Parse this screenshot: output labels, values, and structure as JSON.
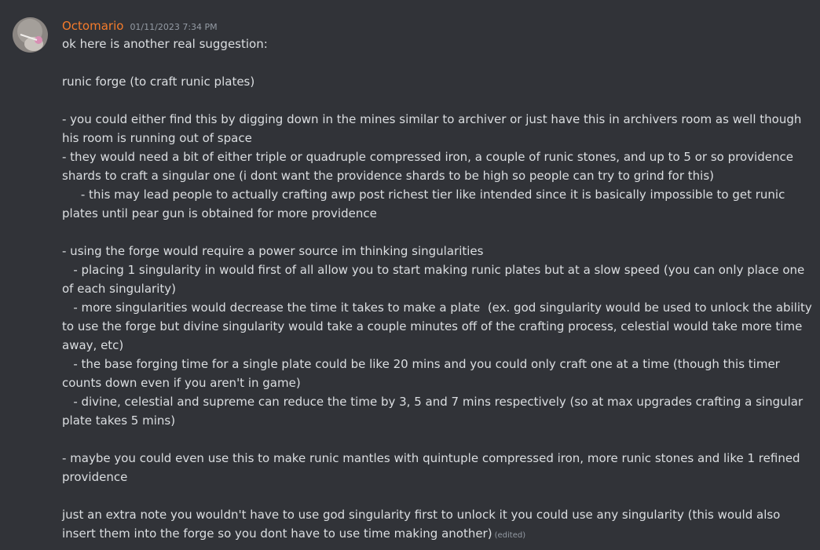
{
  "message": {
    "author": "Octomario",
    "timestamp": "01/11/2023 7:34 PM",
    "edited_label": "(edited)",
    "lines": [
      "ok here is another real suggestion:",
      "",
      "runic forge (to craft runic plates)",
      "",
      "- you could either find this by digging down in the mines similar to archiver or just have this in archivers room as well though his room is running out of space",
      "- they would need a bit of either triple or quadruple compressed iron, a couple of runic stones, and up to 5 or so providence shards to craft a singular one (i dont want the providence shards to be high so people can try to grind for this)",
      "     - this may lead people to actually crafting awp post richest tier like intended since it is basically impossible to get runic plates until pear gun is obtained for more providence",
      "",
      "- using the forge would require a power source im thinking singularities",
      "   - placing 1 singularity in would first of all allow you to start making runic plates but at a slow speed (you can only place one of each singularity)",
      "   - more singularities would decrease the time it takes to make a plate  (ex. god singularity would be used to unlock the ability to use the forge but divine singularity would take a couple minutes off of the crafting process, celestial would take more time away, etc)",
      "   - the base forging time for a single plate could be like 20 mins and you could only craft one at a time (though this timer counts down even if you aren't in game)",
      "   - divine, celestial and supreme can reduce the time by 3, 5 and 7 mins respectively (so at max upgrades crafting a singular plate takes 5 mins)",
      "",
      "- maybe you could even use this to make runic mantles with quintuple compressed iron, more runic stones and like 1 refined providence",
      "",
      "just an extra note you wouldn't have to use god singularity first to unlock it you could use any singularity (this would also insert them into the forge so you dont have to use time making another)"
    ]
  },
  "colors": {
    "background": "#313338",
    "text": "#dbdee1",
    "username": "#f47b2b",
    "muted": "#949ba4"
  }
}
